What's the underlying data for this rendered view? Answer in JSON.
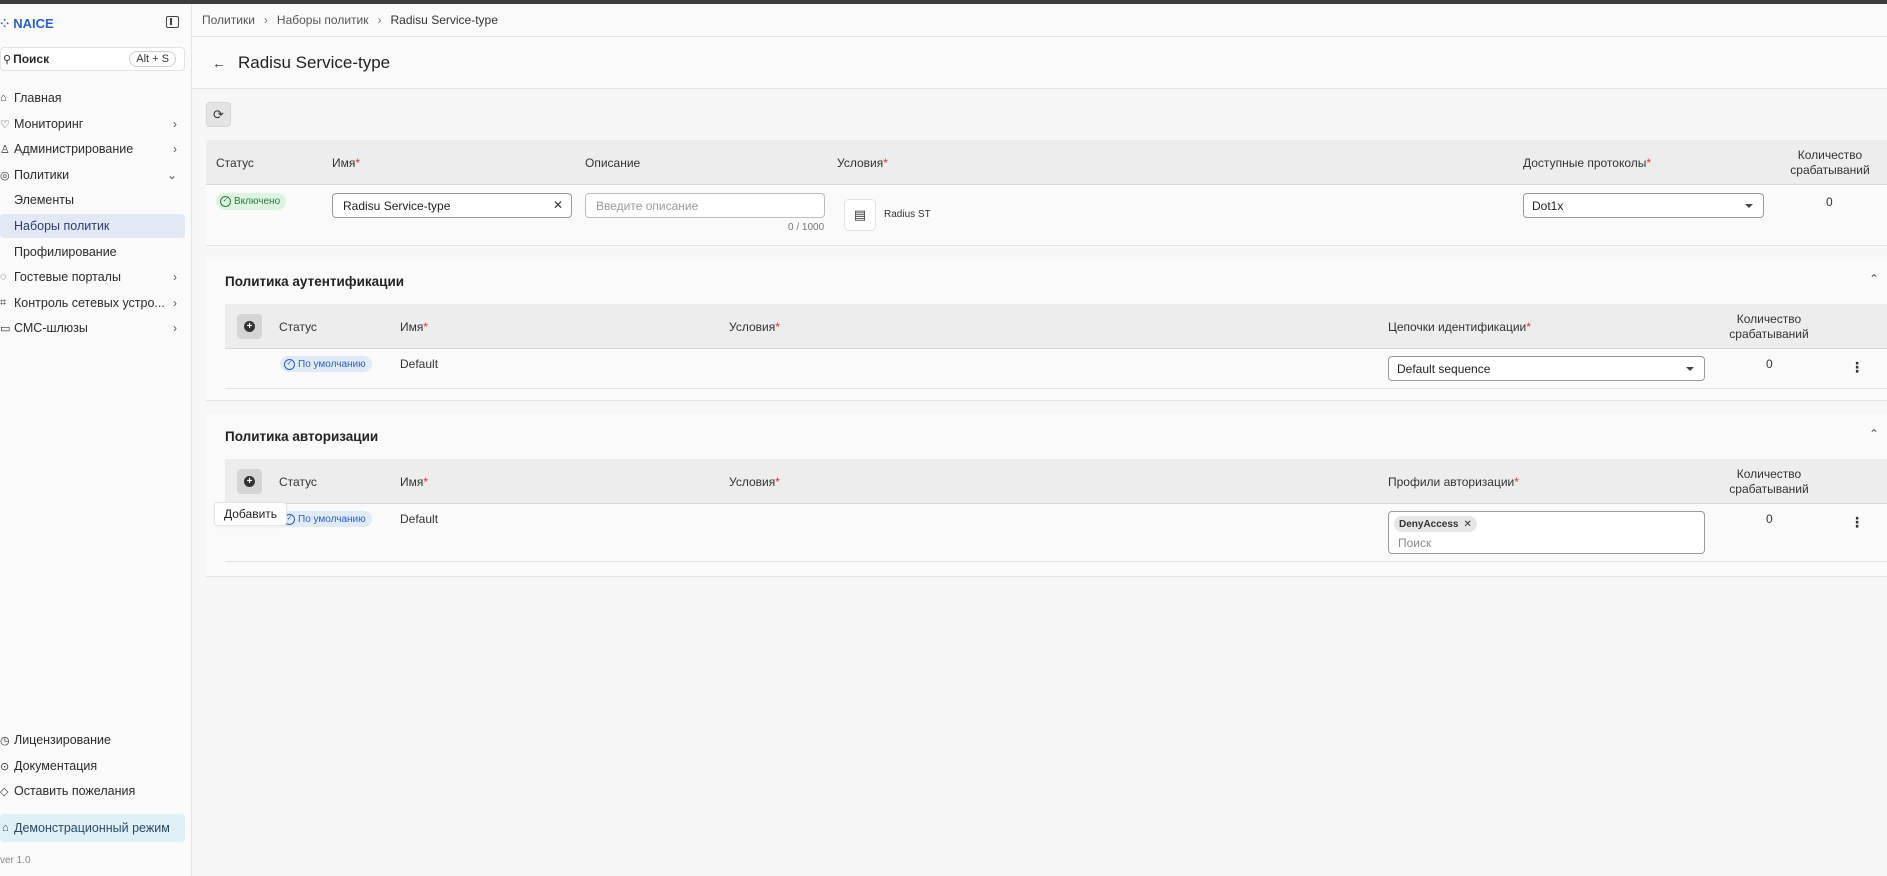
{
  "app": {
    "name": "NAICE",
    "version": "ver 1.0"
  },
  "search": {
    "label": "Поиск",
    "shortcut": "Alt + S"
  },
  "sidebar": {
    "items": [
      {
        "label": "Главная",
        "icon": "home-icon"
      },
      {
        "label": "Мониторинг",
        "icon": "monitor-icon"
      },
      {
        "label": "Администрирование",
        "icon": "admin-icon"
      },
      {
        "label": "Политики",
        "icon": "policy-icon"
      },
      {
        "label": "Гостевые порталы",
        "icon": "portal-icon"
      },
      {
        "label": "Контроль сетевых устро...",
        "icon": "device-icon"
      },
      {
        "label": "СМС-шлюзы",
        "icon": "sms-icon"
      }
    ],
    "subitems": [
      {
        "label": "Элементы"
      },
      {
        "label": "Наборы политик"
      },
      {
        "label": "Профилирование"
      }
    ],
    "bottom": [
      {
        "label": "Лицензирование",
        "icon": "license-icon"
      },
      {
        "label": "Документация",
        "icon": "doc-icon"
      },
      {
        "label": "Оставить пожелания",
        "icon": "feedback-icon"
      }
    ],
    "demo": "Демонстрационный режим"
  },
  "breadcrumb": [
    "Политики",
    "Наборы политик",
    "Radisu Service-type"
  ],
  "page": {
    "title": "Radisu Service-type"
  },
  "policy_set": {
    "headers": {
      "status": "Статус",
      "name": "Имя",
      "description": "Описание",
      "conditions": "Условия",
      "protocols": "Доступные протоколы",
      "hits": "Количество срабатываний"
    },
    "row": {
      "status": "Включено",
      "name": "Radisu Service-type",
      "description_placeholder": "Введите описание",
      "counter": "0 / 1000",
      "condition": "Radius ST",
      "protocol": "Dot1x",
      "hits": "0"
    }
  },
  "auth_policy": {
    "title": "Политика аутентификации",
    "headers": {
      "status": "Статус",
      "name": "Имя",
      "conditions": "Условия",
      "chains": "Цепочки идентификации",
      "hits": "Количество срабатываний"
    },
    "row": {
      "status": "По умолчанию",
      "name": "Default",
      "chain": "Default sequence",
      "hits": "0"
    }
  },
  "authz_policy": {
    "title": "Политика авторизации",
    "headers": {
      "status": "Статус",
      "name": "Имя",
      "conditions": "Условия",
      "profiles": "Профили авторизации",
      "hits": "Количество срабатываний"
    },
    "row": {
      "status": "По умолчанию",
      "name": "Default",
      "profile_chip": "DenyAccess",
      "search_placeholder": "Поиск",
      "hits": "0"
    }
  },
  "tooltip": "Добавить",
  "colors": {
    "accent": "#2c5fc1",
    "enabled": "#2a7a3e",
    "required": "#d33333"
  }
}
